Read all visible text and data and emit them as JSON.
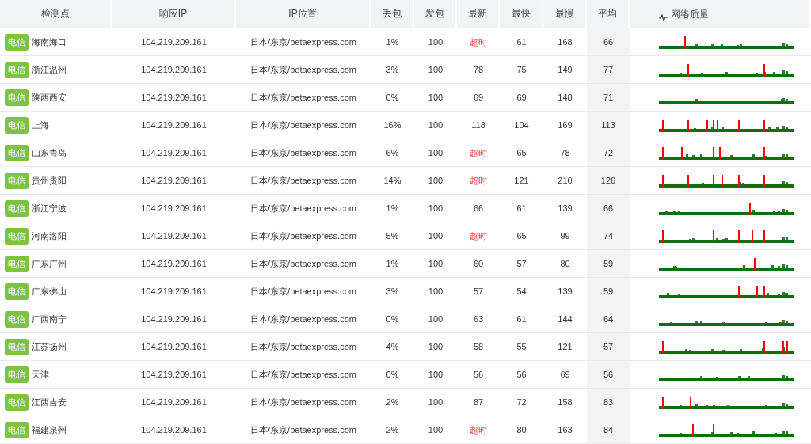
{
  "table": {
    "columns": [
      "检测点",
      "响应IP",
      "IP位置",
      "丢包",
      "发包",
      "最新",
      "最快",
      "最慢",
      "平均",
      "网络质量"
    ],
    "rows": [
      {
        "isp": "电信",
        "node": "海南海口",
        "ip": "104.219.209.161",
        "location": "日本/东京/petaexpress.com",
        "loss": "1%",
        "sent": "100",
        "latest": "超时",
        "latest_timeout": true,
        "fastest": "61",
        "slowest": "168",
        "average": "66"
      },
      {
        "isp": "电信",
        "node": "浙江温州",
        "ip": "104.219.209.161",
        "location": "日本/东京/petaexpress.com",
        "loss": "3%",
        "sent": "100",
        "latest": "78",
        "latest_timeout": false,
        "fastest": "75",
        "slowest": "149",
        "average": "77"
      },
      {
        "isp": "电信",
        "node": "陕西西安",
        "ip": "104.219.209.161",
        "location": "日本/东京/petaexpress.com",
        "loss": "0%",
        "sent": "100",
        "latest": "69",
        "latest_timeout": false,
        "fastest": "69",
        "slowest": "148",
        "average": "71"
      },
      {
        "isp": "电信",
        "node": "上海",
        "ip": "104.219.209.161",
        "location": "日本/东京/petaexpress.com",
        "loss": "16%",
        "sent": "100",
        "latest": "118",
        "latest_timeout": false,
        "fastest": "104",
        "slowest": "169",
        "average": "113"
      },
      {
        "isp": "电信",
        "node": "山东青岛",
        "ip": "104.219.209.161",
        "location": "日本/东京/petaexpress.com",
        "loss": "6%",
        "sent": "100",
        "latest": "超时",
        "latest_timeout": true,
        "fastest": "65",
        "slowest": "78",
        "average": "72"
      },
      {
        "isp": "电信",
        "node": "贵州贵阳",
        "ip": "104.219.209.161",
        "location": "日本/东京/petaexpress.com",
        "loss": "14%",
        "sent": "100",
        "latest": "超时",
        "latest_timeout": true,
        "fastest": "121",
        "slowest": "210",
        "average": "126"
      },
      {
        "isp": "电信",
        "node": "浙江宁波",
        "ip": "104.219.209.161",
        "location": "日本/东京/petaexpress.com",
        "loss": "1%",
        "sent": "100",
        "latest": "66",
        "latest_timeout": false,
        "fastest": "61",
        "slowest": "139",
        "average": "66"
      },
      {
        "isp": "电信",
        "node": "河南洛阳",
        "ip": "104.219.209.161",
        "location": "日本/东京/petaexpress.com",
        "loss": "5%",
        "sent": "100",
        "latest": "超时",
        "latest_timeout": true,
        "fastest": "65",
        "slowest": "99",
        "average": "74"
      },
      {
        "isp": "电信",
        "node": "广东广州",
        "ip": "104.219.209.161",
        "location": "日本/东京/petaexpress.com",
        "loss": "1%",
        "sent": "100",
        "latest": "60",
        "latest_timeout": false,
        "fastest": "57",
        "slowest": "80",
        "average": "59"
      },
      {
        "isp": "电信",
        "node": "广东佛山",
        "ip": "104.219.209.161",
        "location": "日本/东京/petaexpress.com",
        "loss": "3%",
        "sent": "100",
        "latest": "57",
        "latest_timeout": false,
        "fastest": "54",
        "slowest": "139",
        "average": "59"
      },
      {
        "isp": "电信",
        "node": "广西南宁",
        "ip": "104.219.209.161",
        "location": "日本/东京/petaexpress.com",
        "loss": "0%",
        "sent": "100",
        "latest": "63",
        "latest_timeout": false,
        "fastest": "61",
        "slowest": "144",
        "average": "64"
      },
      {
        "isp": "电信",
        "node": "江苏扬州",
        "ip": "104.219.209.161",
        "location": "日本/东京/petaexpress.com",
        "loss": "4%",
        "sent": "100",
        "latest": "58",
        "latest_timeout": false,
        "fastest": "55",
        "slowest": "121",
        "average": "57"
      },
      {
        "isp": "电信",
        "node": "天津",
        "ip": "104.219.209.161",
        "location": "日本/东京/petaexpress.com",
        "loss": "0%",
        "sent": "100",
        "latest": "56",
        "latest_timeout": false,
        "fastest": "56",
        "slowest": "69",
        "average": "56"
      },
      {
        "isp": "电信",
        "node": "江西吉安",
        "ip": "104.219.209.161",
        "location": "日本/东京/petaexpress.com",
        "loss": "2%",
        "sent": "100",
        "latest": "87",
        "latest_timeout": false,
        "fastest": "72",
        "slowest": "158",
        "average": "83"
      },
      {
        "isp": "电信",
        "node": "福建泉州",
        "ip": "104.219.209.161",
        "location": "日本/东京/petaexpress.com",
        "loss": "2%",
        "sent": "100",
        "latest": "超时",
        "latest_timeout": true,
        "fastest": "80",
        "slowest": "163",
        "average": "84"
      }
    ]
  }
}
